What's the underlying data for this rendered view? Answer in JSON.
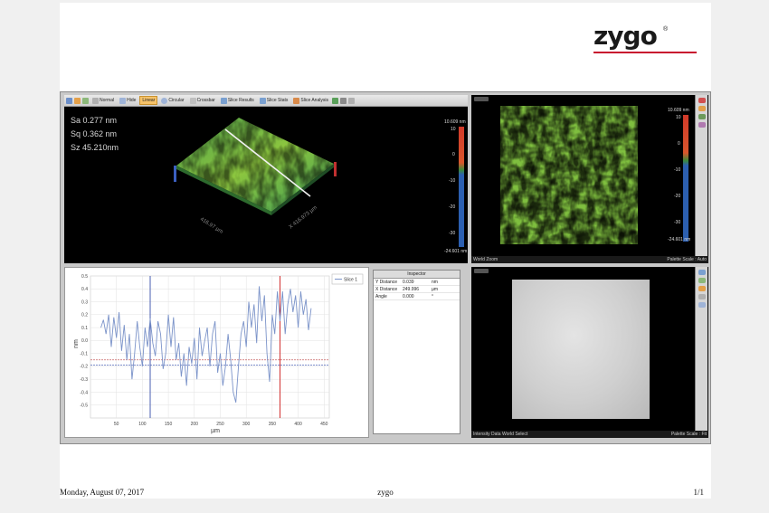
{
  "brand": {
    "name": "zygo",
    "mark": "®",
    "accent": "#c8102e"
  },
  "toolbar": {
    "items": [
      {
        "label": "Normal",
        "icon": "normal-view-icon"
      },
      {
        "label": "Hide",
        "icon": "hide-icon"
      },
      {
        "label": "Linear",
        "icon": "linear-slice-icon",
        "active": true
      },
      {
        "label": "Circular",
        "icon": "circular-slice-icon"
      },
      {
        "label": "Crossbar",
        "icon": "crossbar-icon"
      },
      {
        "label": "Slice Results",
        "icon": "slice-results-icon"
      },
      {
        "label": "Slice Stats",
        "icon": "slice-stats-icon"
      },
      {
        "label": "Slice Analysis",
        "icon": "slice-analysis-icon"
      }
    ]
  },
  "stats": {
    "sa": "Sa 0.277   nm",
    "sq": "Sq 0.362   nm",
    "sz": "Sz 45.210nm"
  },
  "plot3d": {
    "x_axis": "X  416.973 µm",
    "y_axis": "416.97 µm"
  },
  "colorbar": {
    "max": "10.609 nm",
    "min": "-24.601 nm",
    "ticks": [
      "10",
      "0",
      "-10",
      "-20",
      "-30"
    ]
  },
  "topright": {
    "status_left": "World  Zoom",
    "status_right": "Palette Scale : Auto"
  },
  "bottomright": {
    "status_left": "Intensity Data   World   Select",
    "status_right": "Palette Scale : Fit"
  },
  "inspector": {
    "title": "Inspector",
    "rows": [
      {
        "label": "Y Distance",
        "value": "0.039",
        "unit": "nm"
      },
      {
        "label": "X Distance",
        "value": "249.996",
        "unit": "µm"
      },
      {
        "label": "Angle",
        "value": "0.000",
        "unit": "°"
      }
    ]
  },
  "chart_data": {
    "type": "line",
    "title": "",
    "xlabel": "µm",
    "ylabel": "nm",
    "xlim": [
      0,
      460
    ],
    "ylim": [
      -0.6,
      0.5
    ],
    "x_ticks": [
      50,
      100,
      150,
      200,
      250,
      300,
      350,
      400,
      450
    ],
    "y_ticks": [
      0.5,
      0.4,
      0.3,
      0.2,
      0.1,
      0,
      -0.1,
      -0.2,
      -0.3,
      -0.4,
      -0.5
    ],
    "grid": true,
    "legend": "top-right",
    "series": [
      {
        "name": "Slice 1",
        "color": "#7b93c9",
        "x": [
          20,
          25,
          30,
          35,
          40,
          45,
          50,
          55,
          60,
          65,
          70,
          75,
          80,
          85,
          90,
          95,
          100,
          105,
          110,
          115,
          120,
          125,
          130,
          135,
          140,
          145,
          150,
          155,
          160,
          165,
          170,
          175,
          180,
          185,
          190,
          195,
          200,
          205,
          210,
          215,
          220,
          225,
          230,
          235,
          240,
          245,
          250,
          255,
          260,
          265,
          270,
          275,
          280,
          285,
          290,
          295,
          300,
          305,
          310,
          315,
          320,
          325,
          330,
          335,
          340,
          345,
          350,
          355,
          360,
          365,
          370,
          375,
          380,
          385,
          390,
          395,
          400,
          405,
          410,
          415,
          420,
          425
        ],
        "y": [
          0.1,
          0.16,
          0.05,
          0.2,
          -0.05,
          0.18,
          0.02,
          0.22,
          -0.08,
          0.12,
          -0.15,
          0.05,
          -0.3,
          -0.1,
          0.15,
          -0.05,
          -0.2,
          0.1,
          -0.05,
          0.17,
          -0.02,
          -0.12,
          0.15,
          0.05,
          -0.22,
          -0.1,
          0.2,
          -0.05,
          0.18,
          -0.15,
          -0.02,
          -0.28,
          -0.1,
          -0.35,
          -0.05,
          -0.18,
          0.02,
          -0.3,
          0.1,
          -0.12,
          0.0,
          0.1,
          -0.2,
          0.05,
          0.15,
          -0.25,
          -0.1,
          -0.35,
          -0.2,
          0.05,
          -0.15,
          -0.4,
          -0.48,
          -0.2,
          0.05,
          0.15,
          -0.05,
          0.3,
          0.1,
          0.28,
          -0.02,
          0.42,
          0.15,
          0.35,
          -0.1,
          -0.32,
          0.2,
          0.05,
          0.38,
          0.15,
          0.38,
          0.05,
          0.28,
          0.4,
          0.22,
          0.35,
          0.1,
          0.38,
          0.2,
          0.32,
          0.08,
          0.25
        ]
      }
    ],
    "cursors": [
      {
        "x": 115,
        "color": "#4a5fb0"
      },
      {
        "x": 365,
        "color": "#d23030"
      }
    ],
    "ref_lines": [
      {
        "y": -0.15,
        "color": "#c86060"
      },
      {
        "y": -0.19,
        "color": "#5a6fc0"
      }
    ]
  },
  "footer": {
    "date": "Monday, August 07, 2017",
    "center": "zygo",
    "page": "1/1"
  }
}
